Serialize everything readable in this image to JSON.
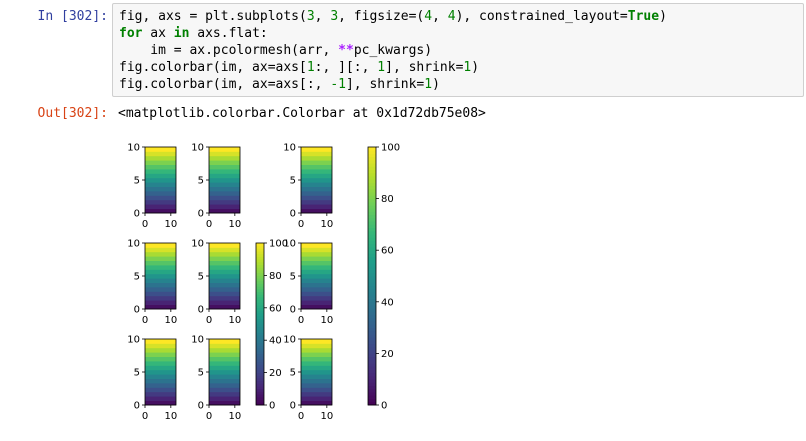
{
  "input_prompt": "In  [302]:",
  "output_prompt": "Out[302]:",
  "code": {
    "line1": {
      "a": "fig, axs = plt.subplots(",
      "n1": "3",
      "b": ", ",
      "n2": "3",
      "c": ", figsize=(",
      "n3": "4",
      "d": ", ",
      "n4": "4",
      "e": "), constrained_layout=",
      "kwTrue": "True",
      "f": ")"
    },
    "line2": {
      "kw1": "for",
      "a": " ax ",
      "kw2": "in",
      "b": " axs.flat:"
    },
    "line3": {
      "a": "    im = ax.pcolormesh(arr, ",
      "op": "**",
      "b": "pc_kwargs)"
    },
    "line4": {
      "a": "fig.colorbar(im, ax=axs[",
      "n1": "1",
      "b": ":, ][:, ",
      "n2": "1",
      "c": "], shrink=",
      "n3": "1",
      "d": ")"
    },
    "line5": {
      "a": "fig.colorbar(im, ax=axs[:, ",
      "n1": "-1",
      "b": "], shrink=",
      "n2": "1",
      "c": ")"
    }
  },
  "output_text": "<matplotlib.colorbar.Colorbar at 0x1d72db75e08>",
  "chart_data": {
    "type": "heatmap",
    "colormap": "viridis",
    "grid": "3x3",
    "panel_xlim": [
      0,
      12
    ],
    "panel_ylim": [
      0,
      10
    ],
    "panel_xticks": [
      "0",
      "10"
    ],
    "panel_yticks": [
      "0",
      "5",
      "10"
    ],
    "colorbar_small": {
      "ticks": [
        "0",
        "20",
        "40",
        "60",
        "80",
        "100"
      ],
      "range": [
        0,
        100
      ]
    },
    "colorbar_large": {
      "ticks": [
        "0",
        "20",
        "40",
        "60",
        "80",
        "100"
      ],
      "range": [
        0,
        100
      ]
    },
    "row_values": [
      4,
      10,
      17,
      24,
      31,
      38,
      45,
      52,
      59,
      66,
      73,
      80,
      87,
      94,
      100
    ]
  }
}
